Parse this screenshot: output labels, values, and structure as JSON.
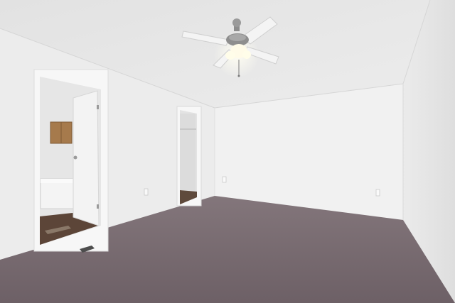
{
  "image": {
    "kind": "photo",
    "subject": "empty-bedroom-interior"
  },
  "palette": {
    "ceiling": "#e6e6e6",
    "wall_left": "#ececec",
    "wall_back": "#f1f1f1",
    "wall_right": "#e4e4e4",
    "carpet": "#7a6c72",
    "carpet_dark": "#6b5e64",
    "floor_wood": "#5c4538",
    "trim": "#f7f7f7",
    "door": "#f3f3f3",
    "cabinet": "#a67a4c",
    "fan_metal": "#8c8c8c",
    "fan_blade": "#f4f4f4",
    "light_glow": "#fffbe8"
  }
}
